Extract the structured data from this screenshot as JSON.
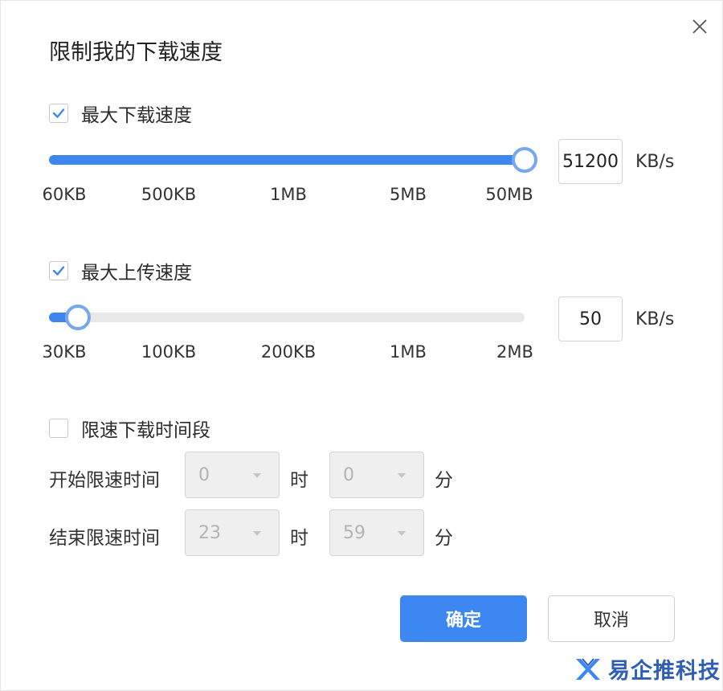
{
  "dialog": {
    "title": "限制我的下载速度"
  },
  "download": {
    "label": "最大下载速度",
    "checked": true,
    "ticks": [
      "60KB",
      "500KB",
      "1MB",
      "5MB",
      "50MB"
    ],
    "value": "51200",
    "unit": "KB/s",
    "slider_fraction": 1.0
  },
  "upload": {
    "label": "最大上传速度",
    "checked": true,
    "ticks": [
      "30KB",
      "100KB",
      "200KB",
      "1MB",
      "2MB"
    ],
    "value": "50",
    "unit": "KB/s",
    "slider_fraction": 0.06
  },
  "schedule": {
    "label": "限速下载时间段",
    "checked": false,
    "start_label": "开始限速时间",
    "end_label": "结束限速时间",
    "start_hour": "0",
    "start_minute": "0",
    "end_hour": "23",
    "end_minute": "59",
    "hour_suffix": "时",
    "minute_suffix": "分"
  },
  "buttons": {
    "ok": "确定",
    "cancel": "取消"
  },
  "watermark": {
    "text": "易企推科技"
  },
  "colors": {
    "accent": "#3c87f2",
    "thumb_border": "#76a8f2",
    "track": "#e8e8e8",
    "watermark": "#2f5fb4"
  },
  "icons": {
    "close": "close-icon",
    "check": "check-icon",
    "caret": "chevron-down-icon",
    "logo": "logo-icon"
  }
}
